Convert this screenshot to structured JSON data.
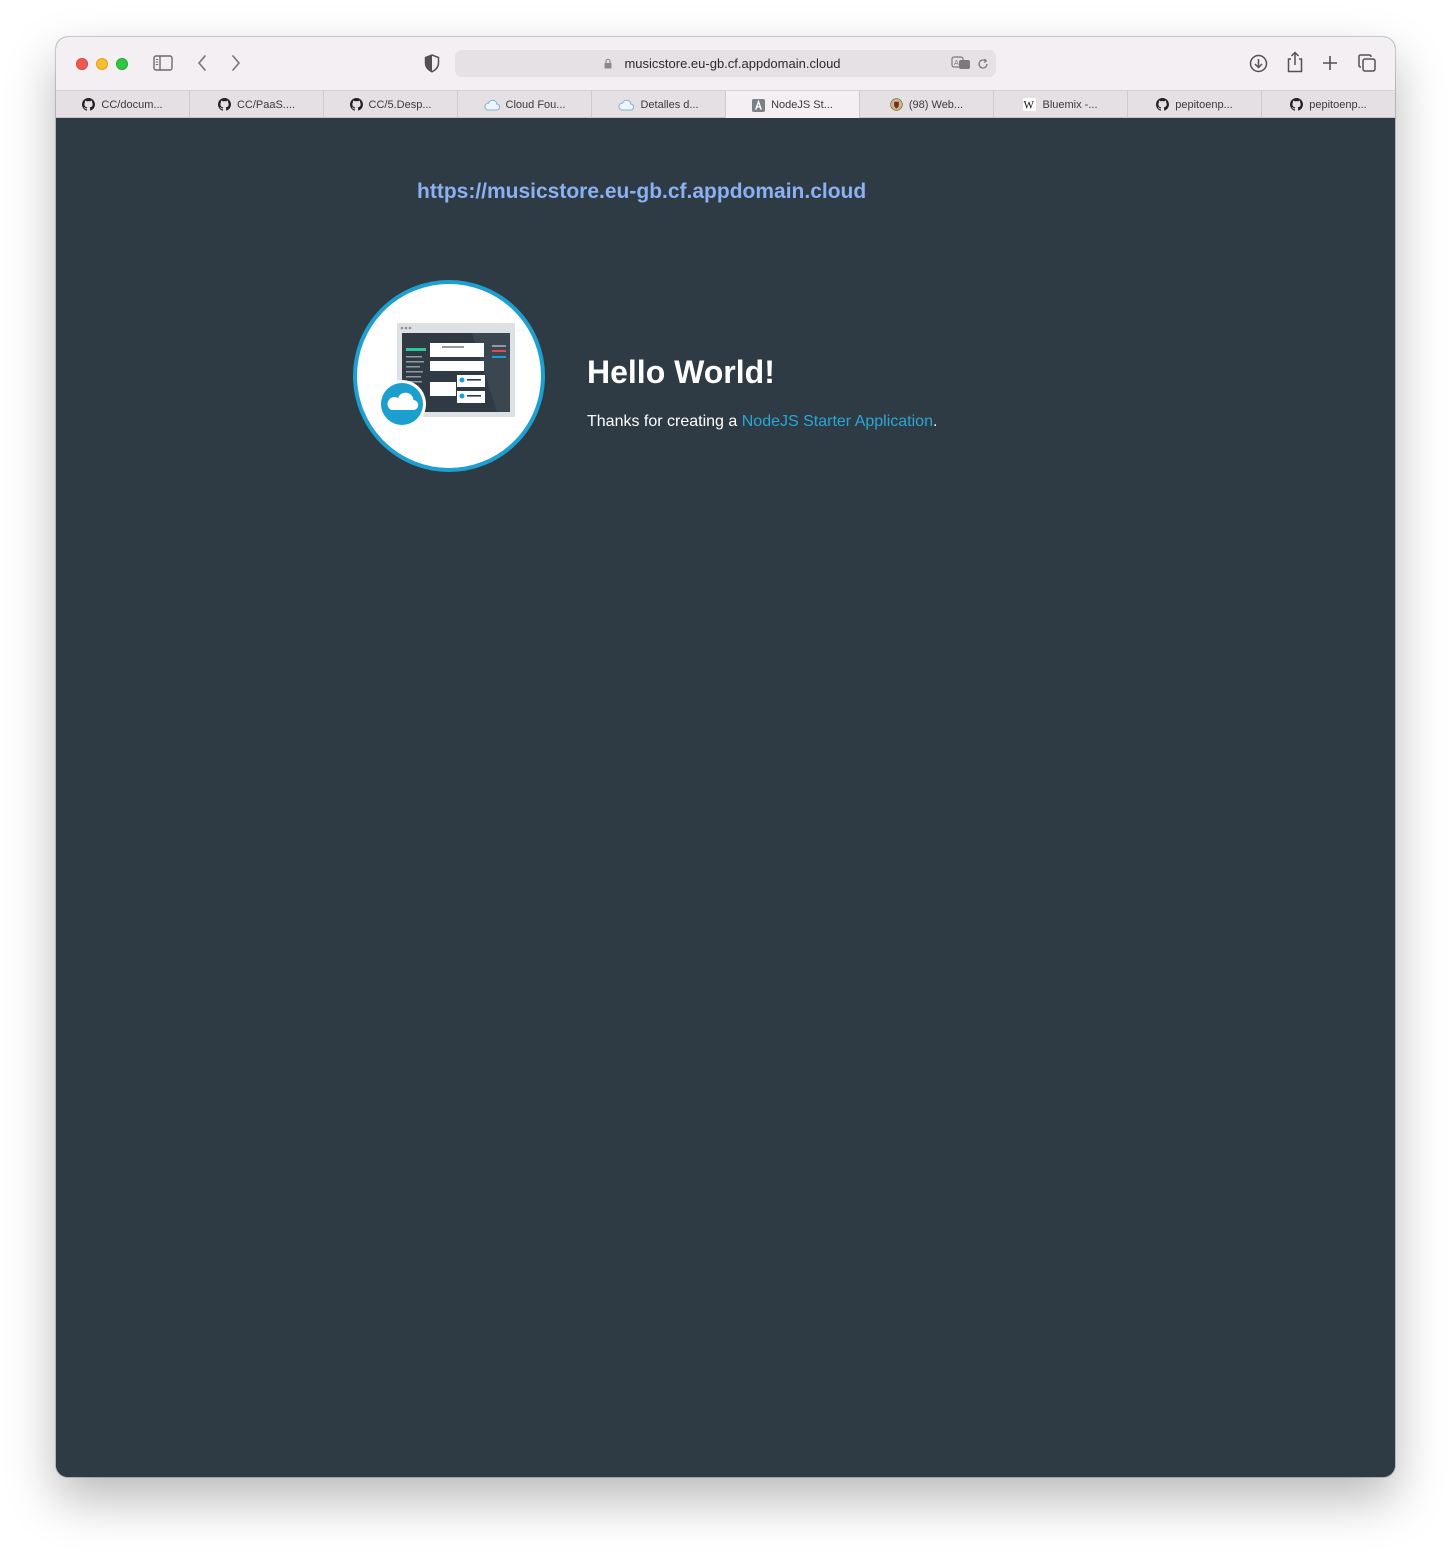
{
  "browser": {
    "address": "musicstore.eu-gb.cf.appdomain.cloud",
    "tabs": [
      {
        "label": "CC/docum...",
        "icon": "github-icon"
      },
      {
        "label": "CC/PaaS....",
        "icon": "github-icon"
      },
      {
        "label": "CC/5.Desp...",
        "icon": "github-icon"
      },
      {
        "label": "Cloud Fou...",
        "icon": "cloud-icon"
      },
      {
        "label": "Detalles d...",
        "icon": "cloud-icon"
      },
      {
        "label": "NodeJS St...",
        "icon": "letter-a-icon",
        "active": true
      },
      {
        "label": "(98) Web...",
        "icon": "crest-icon"
      },
      {
        "label": "Bluemix -...",
        "icon": "wikipedia-icon"
      },
      {
        "label": "pepitoenp...",
        "icon": "github-icon"
      },
      {
        "label": "pepitoenp...",
        "icon": "github-icon"
      }
    ]
  },
  "page": {
    "site_url": "https://musicstore.eu-gb.cf.appdomain.cloud",
    "heading": "Hello World!",
    "thanks_prefix": "Thanks for creating a ",
    "thanks_link": "NodeJS Starter Application",
    "thanks_suffix": "."
  },
  "colors": {
    "page_background": "#2e3a44",
    "url_color": "#8ab1f2",
    "link_color": "#2ba7d6",
    "accent_circle": "#1da0cf"
  }
}
